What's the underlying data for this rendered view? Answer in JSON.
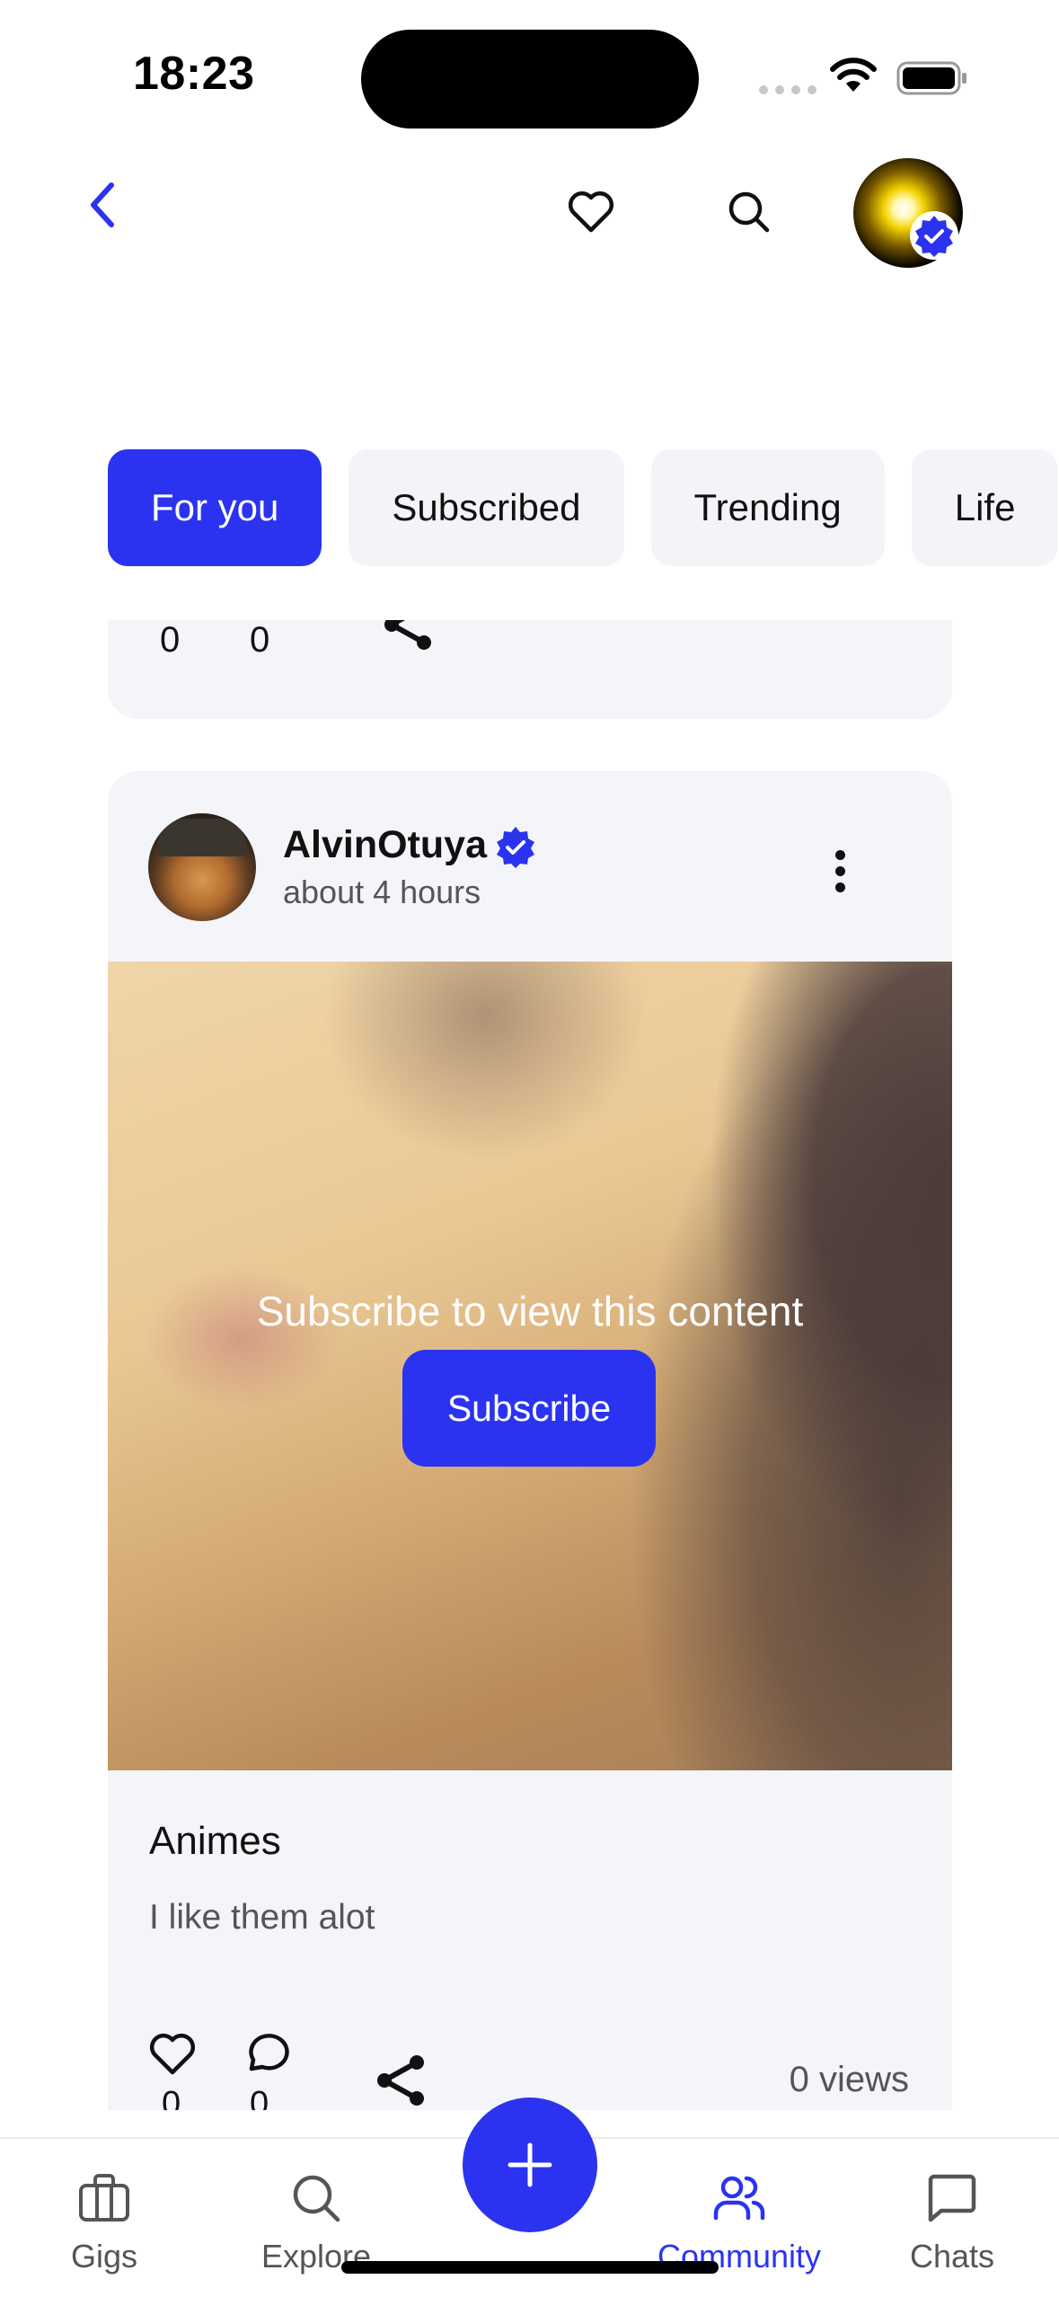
{
  "status_bar": {
    "time": "18:23"
  },
  "colors": {
    "accent": "#2b33f0",
    "card_bg": "#f4f5f9",
    "chip_bg": "#f3f4f8",
    "muted_text": "#555555"
  },
  "header": {
    "icons": [
      "back-chevron-icon",
      "heart-icon",
      "search-icon",
      "profile-avatar",
      "verified-badge-icon"
    ]
  },
  "categories": [
    {
      "label": "For you",
      "active": true
    },
    {
      "label": "Subscribed",
      "active": false
    },
    {
      "label": "Trending",
      "active": false
    },
    {
      "label": "Life",
      "active": false
    }
  ],
  "previous_post": {
    "like_count": "0",
    "comment_count": "0"
  },
  "post": {
    "author": "AlvinOtuya",
    "time": "about 4 hours",
    "locked_message": "Subscribe to view this content",
    "subscribe_label": "Subscribe",
    "title": "Animes",
    "body": "I like them alot",
    "like_count": "0",
    "comment_count": "0",
    "views": "0 views"
  },
  "bottom_nav": [
    {
      "label": "Gigs",
      "icon": "briefcase-icon",
      "active": false
    },
    {
      "label": "Explore",
      "icon": "search-icon",
      "active": false
    },
    {
      "label": "Community",
      "icon": "users-icon",
      "active": true
    },
    {
      "label": "Chats",
      "icon": "chat-icon",
      "active": false
    }
  ],
  "fab": {
    "icon": "plus-icon"
  }
}
